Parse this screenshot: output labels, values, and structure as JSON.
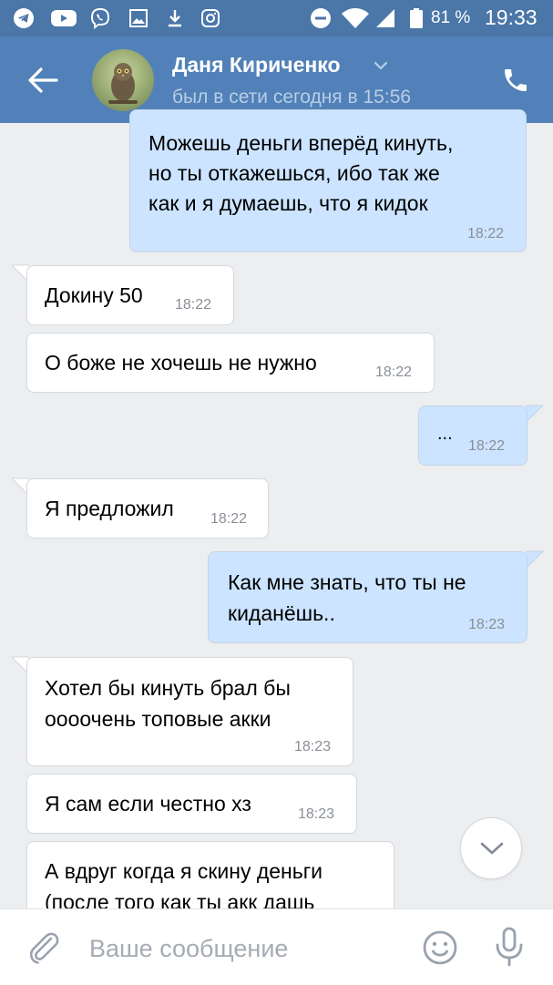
{
  "status_bar": {
    "left_icons": [
      "telegram-icon",
      "youtube-icon",
      "viber-icon",
      "image-icon",
      "download-icon",
      "instagram-icon"
    ],
    "right_icons": [
      "do-not-disturb-icon",
      "wifi-icon",
      "signal-icon",
      "battery-icon"
    ],
    "battery": "81 %",
    "time": "19:33"
  },
  "header": {
    "contact_name": "Даня Кириченко",
    "contact_status": "был в сети сегодня в 15:56",
    "icons": [
      "back-arrow-icon",
      "chevron-down-icon",
      "phone-icon"
    ]
  },
  "messages": [
    {
      "direction": "out",
      "lines": [
        "Можешь деньги вперёд кинуть,",
        "но ты откажешься, ибо так же",
        "как и я думаешь, что я кидок"
      ],
      "time": "18:22"
    },
    {
      "direction": "in",
      "lines": [
        "Докину 50"
      ],
      "time": "18:22"
    },
    {
      "direction": "in",
      "lines": [
        "О боже не хочешь не нужно"
      ],
      "time": "18:22"
    },
    {
      "direction": "out",
      "lines": [
        "..."
      ],
      "time": "18:22"
    },
    {
      "direction": "in",
      "lines": [
        "Я предложил"
      ],
      "time": "18:22"
    },
    {
      "direction": "out",
      "lines": [
        "Как мне знать, что ты не",
        "киданёшь.."
      ],
      "time": "18:23"
    },
    {
      "direction": "in",
      "lines": [
        "Хотел бы кинуть брал бы",
        "оооочень топовые акки"
      ],
      "time": "18:23"
    },
    {
      "direction": "in",
      "lines": [
        "Я сам если честно хз"
      ],
      "time": "18:23"
    },
    {
      "direction": "in",
      "lines": [
        "А вдруг когда я скину деньги",
        "(после того как ты акк дашь"
      ],
      "time": ""
    }
  ],
  "composer": {
    "placeholder": "Ваше сообщение",
    "value": "",
    "icons": [
      "paperclip-icon",
      "emoji-icon",
      "microphone-icon"
    ]
  },
  "colors": {
    "status_bar": "#4a76a8",
    "header": "#5181b8",
    "chat_background": "#edeef0",
    "incoming_bubble": "#ffffff",
    "outgoing_bubble": "#cce4ff"
  }
}
